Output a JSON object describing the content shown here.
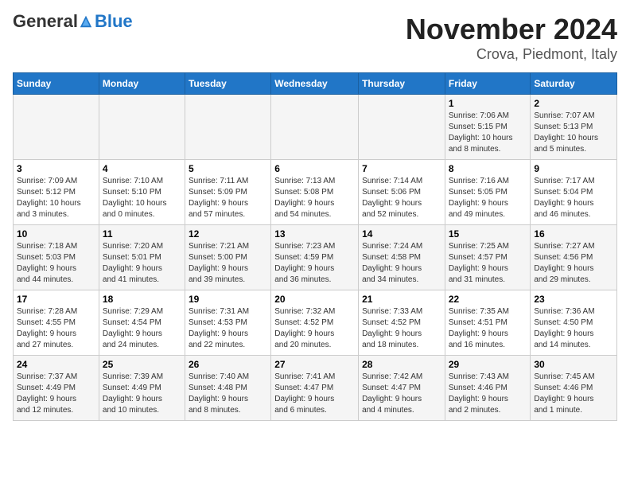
{
  "header": {
    "logo_general": "General",
    "logo_blue": "Blue",
    "title": "November 2024",
    "subtitle": "Crova, Piedmont, Italy"
  },
  "weekdays": [
    "Sunday",
    "Monday",
    "Tuesday",
    "Wednesday",
    "Thursday",
    "Friday",
    "Saturday"
  ],
  "weeks": [
    [
      {
        "day": "",
        "info": ""
      },
      {
        "day": "",
        "info": ""
      },
      {
        "day": "",
        "info": ""
      },
      {
        "day": "",
        "info": ""
      },
      {
        "day": "",
        "info": ""
      },
      {
        "day": "1",
        "info": "Sunrise: 7:06 AM\nSunset: 5:15 PM\nDaylight: 10 hours\nand 8 minutes."
      },
      {
        "day": "2",
        "info": "Sunrise: 7:07 AM\nSunset: 5:13 PM\nDaylight: 10 hours\nand 5 minutes."
      }
    ],
    [
      {
        "day": "3",
        "info": "Sunrise: 7:09 AM\nSunset: 5:12 PM\nDaylight: 10 hours\nand 3 minutes."
      },
      {
        "day": "4",
        "info": "Sunrise: 7:10 AM\nSunset: 5:10 PM\nDaylight: 10 hours\nand 0 minutes."
      },
      {
        "day": "5",
        "info": "Sunrise: 7:11 AM\nSunset: 5:09 PM\nDaylight: 9 hours\nand 57 minutes."
      },
      {
        "day": "6",
        "info": "Sunrise: 7:13 AM\nSunset: 5:08 PM\nDaylight: 9 hours\nand 54 minutes."
      },
      {
        "day": "7",
        "info": "Sunrise: 7:14 AM\nSunset: 5:06 PM\nDaylight: 9 hours\nand 52 minutes."
      },
      {
        "day": "8",
        "info": "Sunrise: 7:16 AM\nSunset: 5:05 PM\nDaylight: 9 hours\nand 49 minutes."
      },
      {
        "day": "9",
        "info": "Sunrise: 7:17 AM\nSunset: 5:04 PM\nDaylight: 9 hours\nand 46 minutes."
      }
    ],
    [
      {
        "day": "10",
        "info": "Sunrise: 7:18 AM\nSunset: 5:03 PM\nDaylight: 9 hours\nand 44 minutes."
      },
      {
        "day": "11",
        "info": "Sunrise: 7:20 AM\nSunset: 5:01 PM\nDaylight: 9 hours\nand 41 minutes."
      },
      {
        "day": "12",
        "info": "Sunrise: 7:21 AM\nSunset: 5:00 PM\nDaylight: 9 hours\nand 39 minutes."
      },
      {
        "day": "13",
        "info": "Sunrise: 7:23 AM\nSunset: 4:59 PM\nDaylight: 9 hours\nand 36 minutes."
      },
      {
        "day": "14",
        "info": "Sunrise: 7:24 AM\nSunset: 4:58 PM\nDaylight: 9 hours\nand 34 minutes."
      },
      {
        "day": "15",
        "info": "Sunrise: 7:25 AM\nSunset: 4:57 PM\nDaylight: 9 hours\nand 31 minutes."
      },
      {
        "day": "16",
        "info": "Sunrise: 7:27 AM\nSunset: 4:56 PM\nDaylight: 9 hours\nand 29 minutes."
      }
    ],
    [
      {
        "day": "17",
        "info": "Sunrise: 7:28 AM\nSunset: 4:55 PM\nDaylight: 9 hours\nand 27 minutes."
      },
      {
        "day": "18",
        "info": "Sunrise: 7:29 AM\nSunset: 4:54 PM\nDaylight: 9 hours\nand 24 minutes."
      },
      {
        "day": "19",
        "info": "Sunrise: 7:31 AM\nSunset: 4:53 PM\nDaylight: 9 hours\nand 22 minutes."
      },
      {
        "day": "20",
        "info": "Sunrise: 7:32 AM\nSunset: 4:52 PM\nDaylight: 9 hours\nand 20 minutes."
      },
      {
        "day": "21",
        "info": "Sunrise: 7:33 AM\nSunset: 4:52 PM\nDaylight: 9 hours\nand 18 minutes."
      },
      {
        "day": "22",
        "info": "Sunrise: 7:35 AM\nSunset: 4:51 PM\nDaylight: 9 hours\nand 16 minutes."
      },
      {
        "day": "23",
        "info": "Sunrise: 7:36 AM\nSunset: 4:50 PM\nDaylight: 9 hours\nand 14 minutes."
      }
    ],
    [
      {
        "day": "24",
        "info": "Sunrise: 7:37 AM\nSunset: 4:49 PM\nDaylight: 9 hours\nand 12 minutes."
      },
      {
        "day": "25",
        "info": "Sunrise: 7:39 AM\nSunset: 4:49 PM\nDaylight: 9 hours\nand 10 minutes."
      },
      {
        "day": "26",
        "info": "Sunrise: 7:40 AM\nSunset: 4:48 PM\nDaylight: 9 hours\nand 8 minutes."
      },
      {
        "day": "27",
        "info": "Sunrise: 7:41 AM\nSunset: 4:47 PM\nDaylight: 9 hours\nand 6 minutes."
      },
      {
        "day": "28",
        "info": "Sunrise: 7:42 AM\nSunset: 4:47 PM\nDaylight: 9 hours\nand 4 minutes."
      },
      {
        "day": "29",
        "info": "Sunrise: 7:43 AM\nSunset: 4:46 PM\nDaylight: 9 hours\nand 2 minutes."
      },
      {
        "day": "30",
        "info": "Sunrise: 7:45 AM\nSunset: 4:46 PM\nDaylight: 9 hours\nand 1 minute."
      }
    ]
  ]
}
